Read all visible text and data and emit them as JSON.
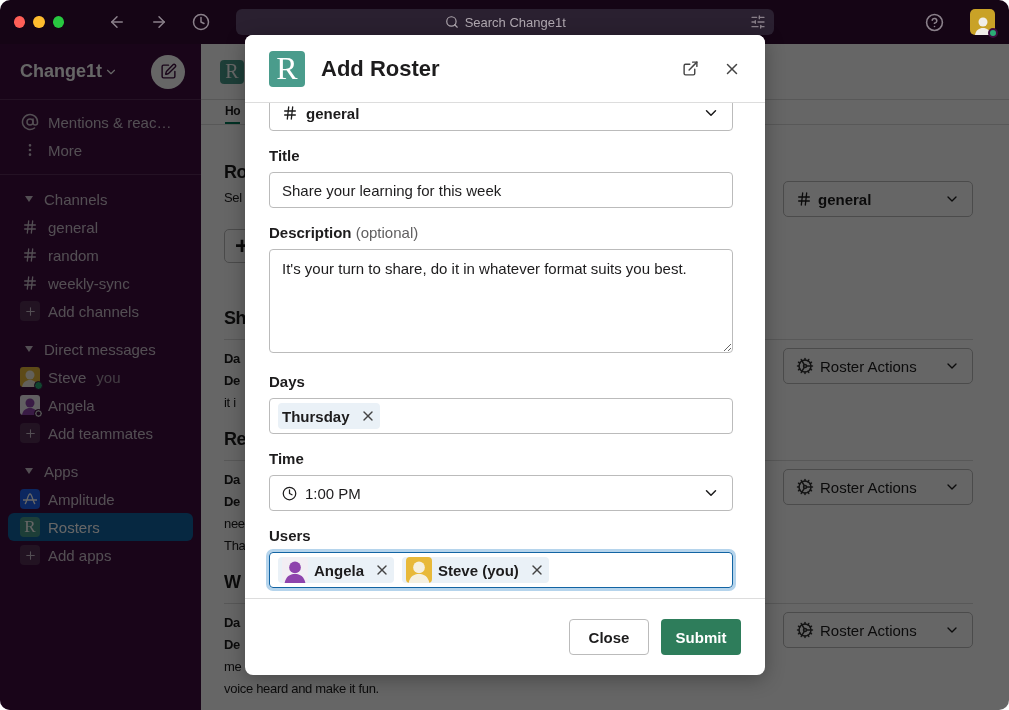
{
  "titlebar": {
    "search_placeholder": "Search Change1t"
  },
  "sidebar": {
    "workspace": "Change1t",
    "top_items": [
      {
        "kind": "mentions",
        "label": "Mentions & reac…"
      },
      {
        "kind": "more",
        "label": "More"
      }
    ],
    "sections": [
      {
        "title": "Channels",
        "expanded": true,
        "items": [
          {
            "kind": "channel",
            "label": "general",
            "selected": false
          },
          {
            "kind": "channel",
            "label": "random",
            "selected": false
          },
          {
            "kind": "channel",
            "label": "weekly-sync",
            "selected": false
          },
          {
            "kind": "add",
            "label": "Add channels",
            "selected": false
          }
        ]
      },
      {
        "title": "Direct messages",
        "expanded": true,
        "items": [
          {
            "kind": "person",
            "label": "Steve",
            "note": "you",
            "online": true,
            "selected": false
          },
          {
            "kind": "person",
            "label": "Angela",
            "online": false,
            "selected": false
          },
          {
            "kind": "add",
            "label": "Add teammates",
            "selected": false
          }
        ]
      },
      {
        "title": "Apps",
        "expanded": true,
        "items": [
          {
            "kind": "amplitude",
            "label": "Amplitude",
            "selected": false
          },
          {
            "kind": "app",
            "letter": "R",
            "label": "Rosters",
            "selected": true
          },
          {
            "kind": "add",
            "label": "Add apps",
            "selected": false
          }
        ]
      }
    ]
  },
  "main": {
    "app_letter": "R",
    "tabs": [
      {
        "label": "Ho",
        "selected": true
      }
    ],
    "sections": [
      {
        "heading": "Ro",
        "lines": [
          {
            "text": "Sel",
            "bold": false
          }
        ],
        "add_button": "+",
        "action": {
          "kind": "channel",
          "label": "general"
        }
      },
      {
        "heading": "Sh",
        "divider": true,
        "lines": [
          {
            "text": "Da",
            "bold": true
          },
          {
            "text": "De",
            "bold": true
          },
          {
            "text": "it i",
            "bold": false
          }
        ],
        "action": {
          "kind": "actions",
          "label": "Roster Actions"
        }
      },
      {
        "heading": "Re",
        "divider": true,
        "lines": [
          {
            "text": "Da",
            "bold": true
          },
          {
            "text": "De",
            "bold": true
          },
          {
            "text": "nee",
            "bold": false
          },
          {
            "text": "Tha",
            "bold": false
          }
        ],
        "action": {
          "kind": "actions",
          "label": "Roster Actions"
        }
      },
      {
        "heading": "W",
        "divider": true,
        "lines": [
          {
            "text": "Da",
            "bold": true
          },
          {
            "text": "De",
            "bold": true
          },
          {
            "text": "me",
            "bold": false
          },
          {
            "text": "voice heard and make it fun.",
            "bold": false
          }
        ],
        "action": {
          "kind": "actions",
          "label": "Roster Actions"
        }
      }
    ]
  },
  "modal": {
    "logo_letter": "R",
    "title": "Add Roster",
    "fields": [
      {
        "kind": "channel-select",
        "value": "general"
      },
      {
        "kind": "text",
        "label": "Title",
        "value": "Share your learning for this week"
      },
      {
        "kind": "textarea",
        "label": "Description",
        "hint": "(optional)",
        "value": "It's your turn to share, do it in whatever format suits you best."
      },
      {
        "kind": "chips",
        "label": "Days",
        "focused": false,
        "chips": [
          {
            "label": "Thursday"
          }
        ]
      },
      {
        "kind": "time",
        "label": "Time",
        "value": "1:00 PM"
      },
      {
        "kind": "chips",
        "label": "Users",
        "focused": true,
        "chips": [
          {
            "label": "Angela",
            "color": "#8e44ad"
          },
          {
            "label": "Steve (you)",
            "color": "#e8b93a"
          }
        ]
      }
    ],
    "buttons": [
      {
        "kind": "secondary",
        "label": "Close"
      },
      {
        "kind": "primary",
        "label": "Submit"
      }
    ]
  }
}
